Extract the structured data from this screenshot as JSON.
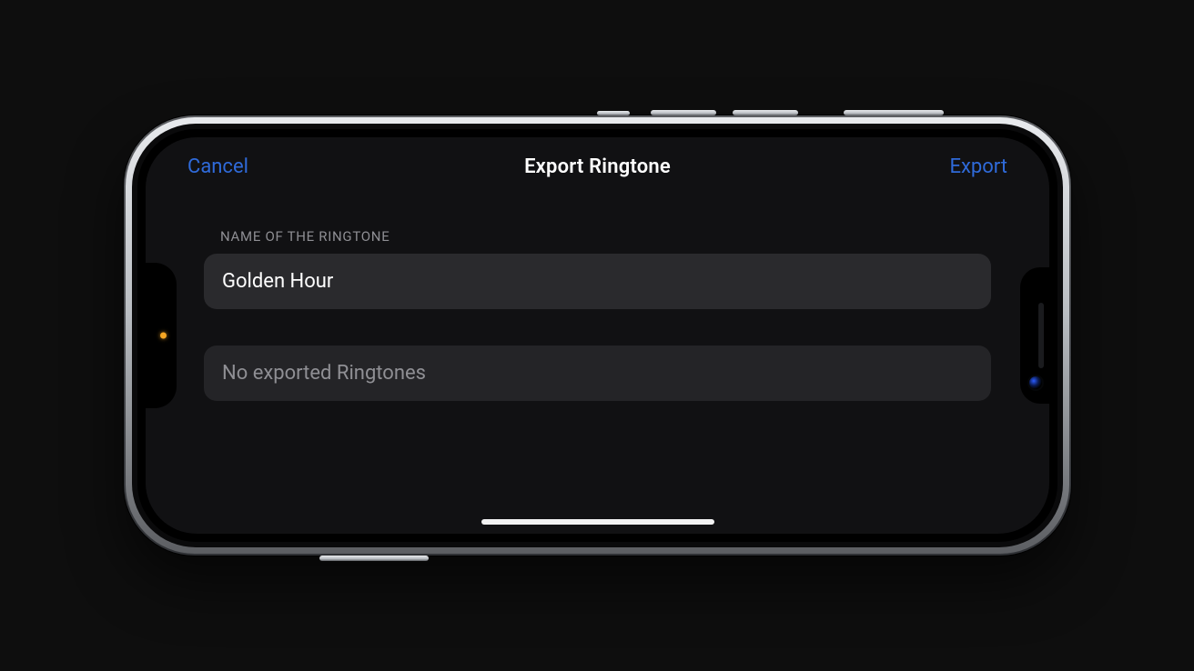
{
  "nav": {
    "cancel_label": "Cancel",
    "title": "Export Ringtone",
    "export_label": "Export"
  },
  "section_name_header": "NAME OF THE RINGTONE",
  "ringtone_name_value": "Golden Hour",
  "empty_state_text": "No exported Ringtones",
  "colors": {
    "accent_blue": "#2f6ad9",
    "screen_bg": "#111113",
    "cell_bg": "#2a2a2d"
  },
  "hardware": {
    "orientation": "landscape",
    "rec_indicator": "amber"
  }
}
